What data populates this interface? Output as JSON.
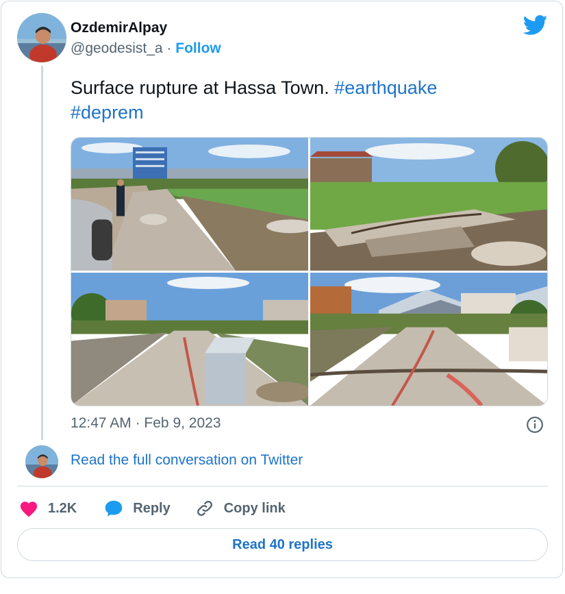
{
  "user": {
    "display_name": "OzdemirAlpay",
    "handle": "@geodesist_a",
    "separator": "·",
    "follow_label": "Follow"
  },
  "tweet": {
    "text": "Surface rupture at Hassa Town.",
    "hashtags": [
      "#earthquake",
      "#deprem"
    ],
    "media": [
      {
        "subject": "street-rupture-car"
      },
      {
        "subject": "field-wall-rubble"
      },
      {
        "subject": "road-bin"
      },
      {
        "subject": "road-mountains"
      }
    ],
    "time": "12:47 AM",
    "date": "Feb 9, 2023"
  },
  "conversation_link": "Read the full conversation on Twitter",
  "actions": {
    "likes": "1.2K",
    "reply": "Reply",
    "copy_link": "Copy link"
  },
  "read_replies": "Read 40 replies",
  "colors": {
    "accent": "#1d9bf0",
    "link": "#1d73c9",
    "like": "#f91880",
    "muted": "#536471",
    "border": "#cfd9de"
  },
  "icons": [
    "twitter-bird-icon",
    "info-icon",
    "heart-icon",
    "reply-bubble-icon",
    "link-icon"
  ]
}
